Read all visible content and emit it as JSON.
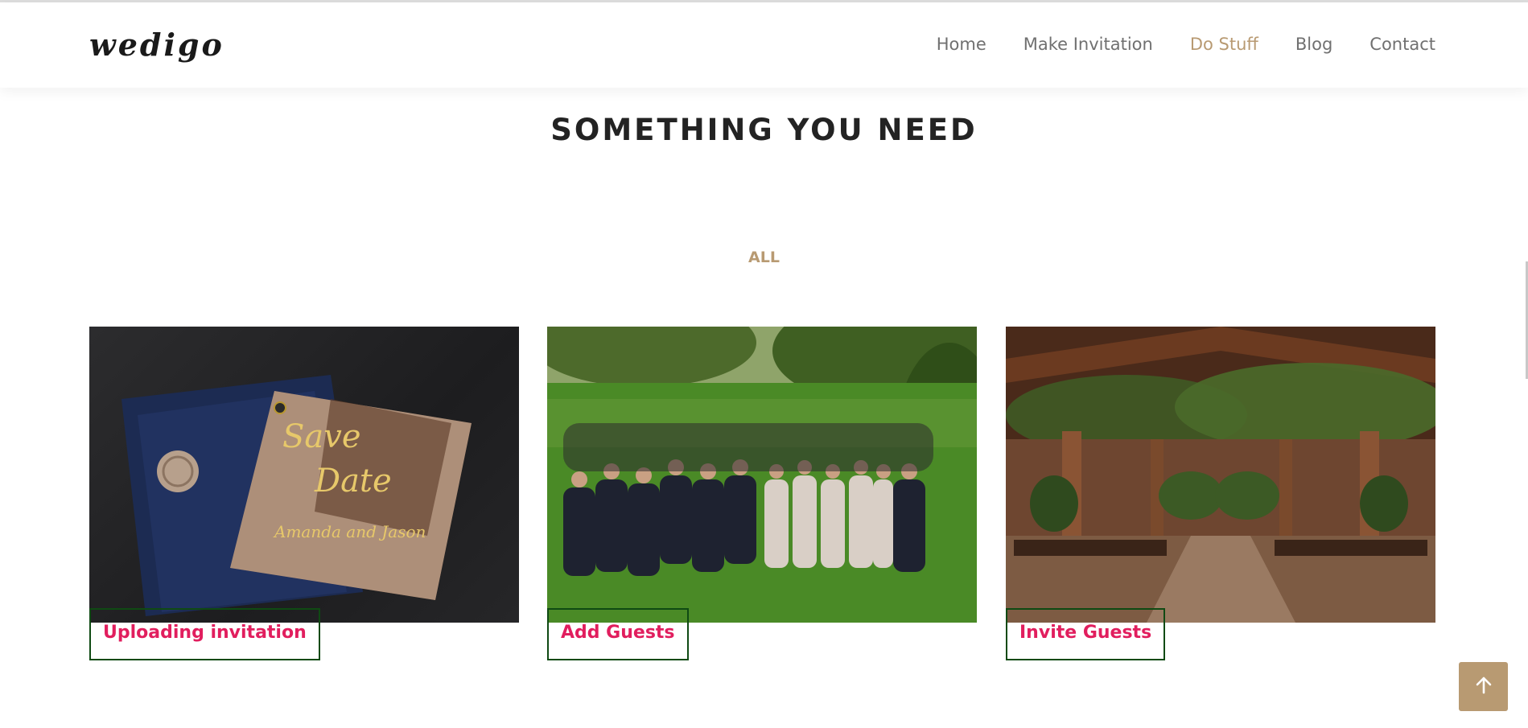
{
  "brand": {
    "logo": "wedigo"
  },
  "nav": [
    {
      "label": "Home",
      "active": false
    },
    {
      "label": "Make Invitation",
      "active": false
    },
    {
      "label": "Do Stuff",
      "active": true
    },
    {
      "label": "Blog",
      "active": false
    },
    {
      "label": "Contact",
      "active": false
    }
  ],
  "section": {
    "title": "SOMETHING YOU NEED",
    "filter_label": "ALL"
  },
  "cards": [
    {
      "label": "Uploading invitation",
      "image": "save-the-date-invitation"
    },
    {
      "label": "Add Guests",
      "image": "wedding-party-group-photo"
    },
    {
      "label": "Invite Guests",
      "image": "rustic-barn-venue"
    }
  ],
  "colors": {
    "accent": "#b89a72",
    "label_text": "#e11e5e",
    "label_border": "#0f4a13",
    "heading": "#232323",
    "nav_text": "#707070"
  },
  "scroll_top": {
    "icon": "arrow-up-icon"
  }
}
